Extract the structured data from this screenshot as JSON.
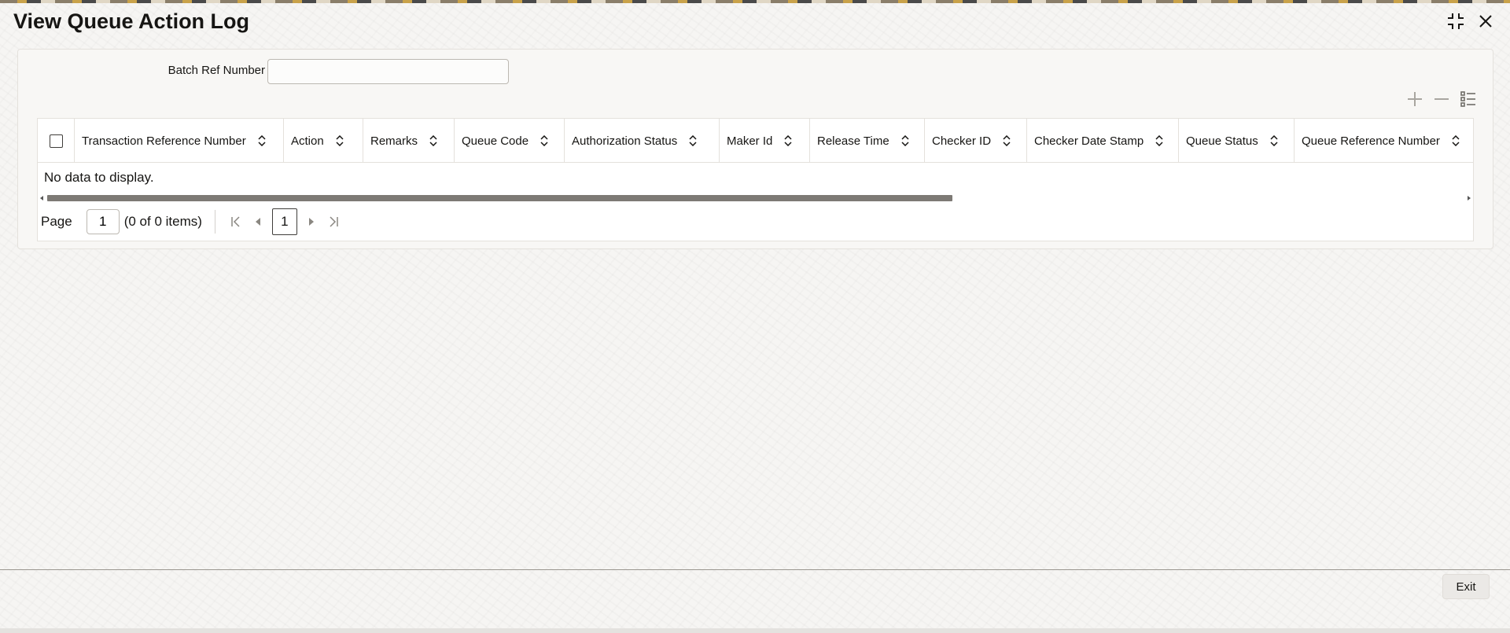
{
  "window": {
    "title": "View Queue Action Log",
    "icons": [
      "minimize-icon",
      "close-icon"
    ]
  },
  "form": {
    "batch_ref_label": "Batch Ref Number",
    "batch_ref_value": "",
    "batch_ref_placeholder": ""
  },
  "grid_tools": [
    "add-row-icon",
    "delete-row-icon",
    "single-record-view-icon"
  ],
  "grid": {
    "columns": [
      "Transaction Reference Number",
      "Action",
      "Remarks",
      "Queue Code",
      "Authorization Status",
      "Maker Id",
      "Release Time",
      "Checker ID",
      "Checker Date Stamp",
      "Queue Status",
      "Queue Reference Number"
    ],
    "rows": [],
    "empty_message": "No data to display."
  },
  "pagination": {
    "page_label": "Page",
    "page_value": "1",
    "items_text": "(0 of 0 items)",
    "current_page": "1"
  },
  "footer": {
    "exit_label": "Exit"
  },
  "colors": {
    "text": "#161513",
    "border": "#e4e1dc",
    "scrollbar": "#7d7a75",
    "button_bg": "#ebe9e6"
  }
}
